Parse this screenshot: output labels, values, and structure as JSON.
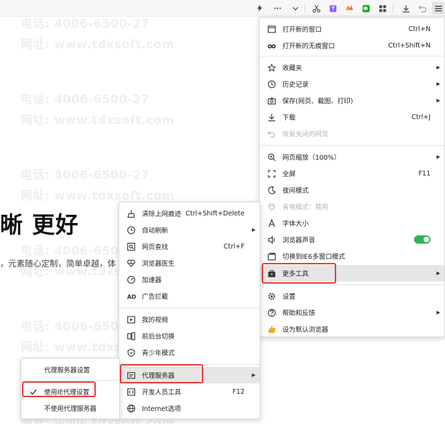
{
  "watermark": {
    "phone": "电话: 4006-6500-27",
    "site": "网址: www.tdxsoft.com"
  },
  "page": {
    "headline": "晰  更好",
    "subline": "，元素随心定制，简单卓越，体"
  },
  "toolbar": {
    "icons": [
      "flash-icon",
      "more-icon",
      "chevron-down-icon",
      "scissors-icon",
      "translate-icon",
      "game-icon",
      "wechat-icon",
      "apps-icon",
      "download-icon",
      "undo-icon",
      "menu-icon"
    ]
  },
  "main_menu": {
    "items": [
      {
        "label": "打开新的窗口",
        "shortcut": "Ctrl+N"
      },
      {
        "label": "打开新的无痕窗口",
        "shortcut": "Ctrl+Shift+N"
      },
      {
        "label": "收藏夹"
      },
      {
        "label": "历史记录"
      },
      {
        "label": "保存(网页、截图、打印)"
      },
      {
        "label": "下载",
        "shortcut": "Ctrl+J"
      },
      {
        "label": "恢复关闭的网页"
      },
      {
        "label": "网页缩放（100%）"
      },
      {
        "label": "全屏",
        "shortcut": "F11"
      },
      {
        "label": "夜间模式"
      },
      {
        "label": "省电模式：禁用"
      },
      {
        "label": "字体大小"
      },
      {
        "label": "浏览器声音"
      },
      {
        "label": "切换到IE6多窗口模式"
      },
      {
        "label": "更多工具"
      },
      {
        "label": "设置"
      },
      {
        "label": "帮助和反馈"
      },
      {
        "label": "设为默认浏览器"
      }
    ]
  },
  "tools_menu": {
    "items": [
      {
        "label": "清除上网痕迹",
        "shortcut": "Ctrl+Shift+Delete"
      },
      {
        "label": "自动刷新"
      },
      {
        "label": "网页查找",
        "shortcut": "Ctrl+F"
      },
      {
        "label": "浏览器医生"
      },
      {
        "label": "加速器"
      },
      {
        "label": "广告拦截"
      },
      {
        "label": "我的视频"
      },
      {
        "label": "前后台切换"
      },
      {
        "label": "青少年模式"
      },
      {
        "label": "代理服务器"
      },
      {
        "label": "开发人员工具",
        "shortcut": "F12"
      },
      {
        "label": "Internet选项"
      }
    ]
  },
  "proxy_menu": {
    "items": [
      {
        "label": "代理服务器设置"
      },
      {
        "label": "使用IE代理设置"
      },
      {
        "label": "不使用代理服务器"
      }
    ]
  },
  "colors": {
    "highlight_box": "#e53935",
    "toggle_on": "#2db55d"
  }
}
